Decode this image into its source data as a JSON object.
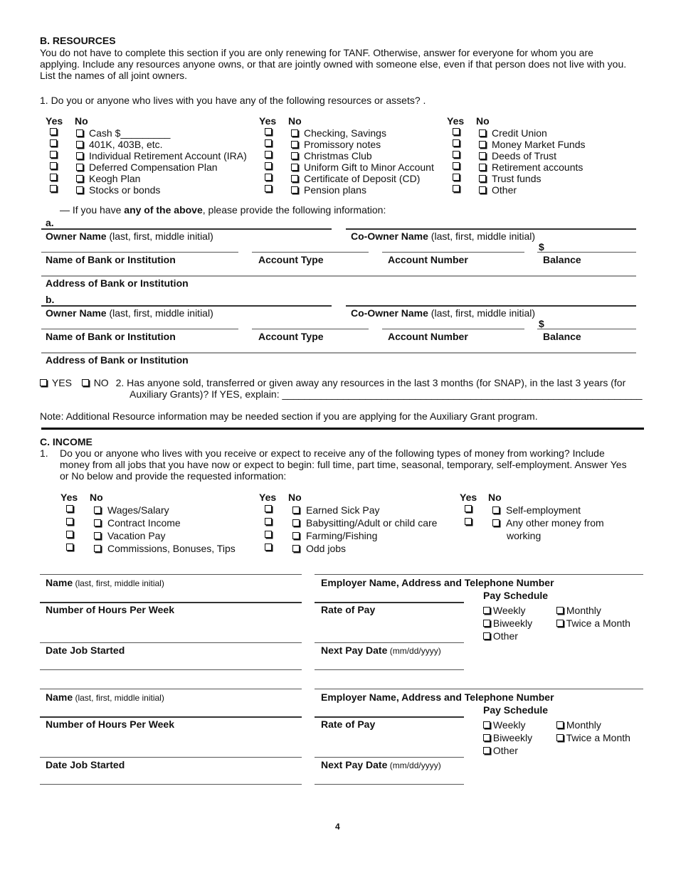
{
  "resources": {
    "title": "B.   RESOURCES",
    "intro_lines": [
      "You do not have to complete this section if you are only renewing for TANF.  Otherwise, answer for everyone for whom you are",
      "applying.  Include any resources anyone owns, or that are jointly owned with someone else, even if that person does not live with you.",
      "List the names of all joint owners."
    ],
    "question1": "1.  Do you or anyone who lives with you have any of the following resources or assets?  .",
    "yes_label": "Yes",
    "no_label": "No",
    "columns": [
      {
        "items": [
          "Cash  $_________",
          "401K, 403B, etc.",
          "Individual Retirement Account (IRA)",
          "Deferred Compensation Plan",
          "Keogh Plan",
          "Stocks or bonds"
        ]
      },
      {
        "items": [
          "Checking, Savings",
          "Promissory notes",
          "Christmas Club",
          "Uniform Gift to Minor Account",
          "Certificate of Deposit (CD)",
          "Pension plans"
        ]
      },
      {
        "items": [
          "Credit Union",
          "Money Market Funds",
          "Deeds of Trust",
          "Retirement accounts",
          "Trust funds",
          "Other"
        ]
      }
    ],
    "if_above_prefix": "— If you have ",
    "if_above_bold": "any of the above",
    "if_above_suffix": ", please provide the following information:",
    "accounts": [
      {
        "letter": "a.",
        "owner_label": "Owner Name",
        "owner_sub": " (last, first, middle initial)",
        "coowner_label": "Co-Owner Name",
        "coowner_sub": " (last, first, middle initial)",
        "bank_label": "Name of Bank or Institution",
        "type_label": "Account Type",
        "number_label": "Account Number",
        "dollar": "$",
        "balance_label": "Balance",
        "address_label": "Address of Bank or Institution"
      },
      {
        "letter": "b.",
        "owner_label": "Owner Name",
        "owner_sub": " (last, first, middle initial)",
        "coowner_label": "Co-Owner Name",
        "coowner_sub": " (last, first, middle initial)",
        "bank_label": "Name of Bank or Institution",
        "type_label": "Account Type",
        "number_label": "Account Number",
        "dollar": "$",
        "balance_label": "Balance",
        "address_label": "Address of Bank or Institution"
      }
    ],
    "q2_yes": "YES",
    "q2_no": "NO",
    "q2_line1": "2.   Has anyone sold, transferred or given away any resources in the last 3 months (for SNAP), in the last 3 years (for",
    "q2_line2": "Auxiliary Grants)?  If YES, explain: _________________________________________________________________",
    "note": "Note:  Additional Resource information may be needed section if you are applying for the Auxiliary Grant program."
  },
  "income": {
    "title": "C.   INCOME",
    "q1_number": "1.",
    "q1_lines": [
      "Do you or anyone who lives with you receive or expect to receive any of the following types of money from working?  Include",
      "money from all jobs that you have now or expect to begin: full time, part time, seasonal, temporary, self-employment.  Answer Yes",
      "or No below and provide the requested information:"
    ],
    "yes_label": "Yes",
    "no_label": "No",
    "columns": [
      {
        "items": [
          "Wages/Salary",
          "Contract Income",
          "Vacation Pay",
          "Commissions, Bonuses, Tips"
        ]
      },
      {
        "items": [
          "Earned Sick Pay",
          "Babysitting/Adult or child care",
          "Farming/Fishing",
          "Odd jobs"
        ]
      },
      {
        "items": [
          "Self-employment",
          "Any other money from"
        ],
        "continuation": "working"
      }
    ],
    "jobs": [
      {
        "name_label": "Name",
        "name_sub": " (last, first, middle initial)",
        "employer_label": "Employer Name, Address and Telephone Number",
        "hours_label": "Number of Hours Per Week",
        "rate_label": "Rate of Pay",
        "pay_schedule_label": "Pay Schedule",
        "pay_options": [
          "Weekly",
          "Monthly",
          "Biweekly",
          "Twice a Month",
          "Other"
        ],
        "date_started_label": "Date Job Started",
        "next_pay_label": "Next Pay Date",
        "next_pay_sub": " (mm/dd/yyyy)"
      },
      {
        "name_label": "Name",
        "name_sub": " (last, first, middle initial)",
        "employer_label": "Employer Name, Address and Telephone Number",
        "hours_label": "Number of Hours Per Week",
        "rate_label": "Rate of Pay",
        "pay_schedule_label": "Pay Schedule",
        "pay_options": [
          "Weekly",
          "Monthly",
          "Biweekly",
          "Twice a Month",
          "Other"
        ],
        "date_started_label": "Date Job Started",
        "next_pay_label": "Next Pay Date",
        "next_pay_sub": " (mm/dd/yyyy)"
      }
    ]
  },
  "page_number": "4"
}
